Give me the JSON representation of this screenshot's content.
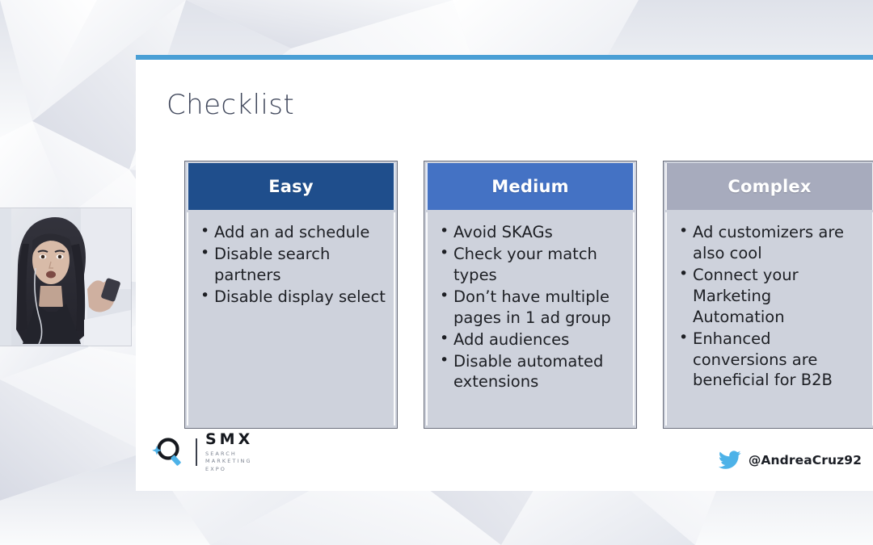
{
  "slide": {
    "title": "Checklist",
    "accent_color": "#4a9fd5",
    "background_color": "#ffffff",
    "columns": [
      {
        "header": "Easy",
        "header_color": "#1f4e8c",
        "body_color": "#ced2dc",
        "items": [
          "Add an ad schedule",
          "Disable search partners",
          "Disable display select"
        ]
      },
      {
        "header": "Medium",
        "header_color": "#4472c4",
        "body_color": "#ced2dc",
        "items": [
          "Avoid SKAGs",
          "Check your match types",
          "Don’t have multiple pages in 1 ad group",
          "Add audiences",
          "Disable automated extensions"
        ]
      },
      {
        "header": "Complex",
        "header_color": "#a7abbd",
        "body_color": "#ced2dc",
        "items": [
          "Ad customizers are also cool",
          "Connect your Marketing Automation",
          "Enhanced conversions are beneficial for B2B"
        ]
      }
    ],
    "footer": {
      "logo_icon": "magnifier-icon",
      "logo_name": "SMX",
      "logo_tagline_line1": "SEARCH",
      "logo_tagline_line2": "MARKETING",
      "logo_tagline_line3": "EXPO",
      "twitter_icon": "twitter-bird-icon",
      "twitter_icon_color": "#4db2e8",
      "twitter_handle": "@AndreaCruz92"
    }
  },
  "stage": {
    "backdrop_description": "geometric-polygon-backdrop",
    "backdrop_color": "#f2f3f6",
    "webcam_label": "presenter-webcam-feed"
  }
}
